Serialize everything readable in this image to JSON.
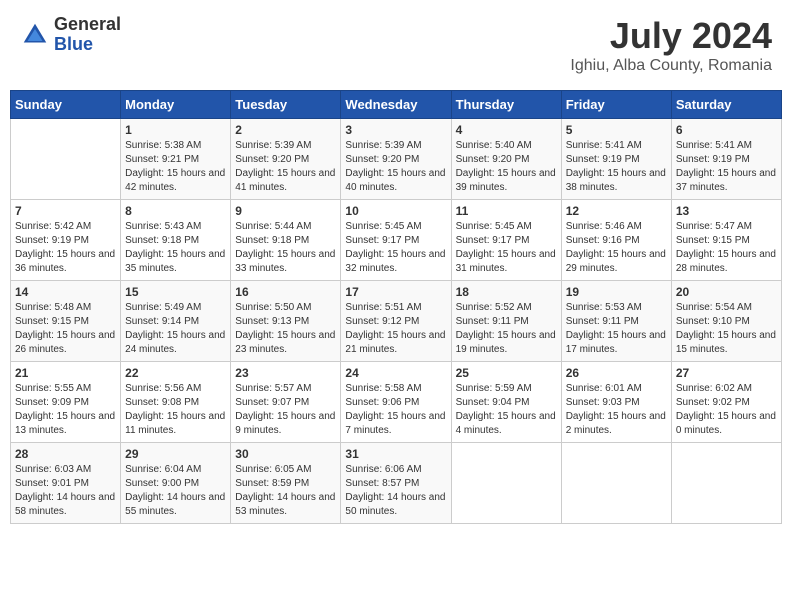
{
  "header": {
    "logo_general": "General",
    "logo_blue": "Blue",
    "month_title": "July 2024",
    "location": "Ighiu, Alba County, Romania"
  },
  "weekdays": [
    "Sunday",
    "Monday",
    "Tuesday",
    "Wednesday",
    "Thursday",
    "Friday",
    "Saturday"
  ],
  "weeks": [
    [
      {
        "day": "",
        "sunrise": "",
        "sunset": "",
        "daylight": ""
      },
      {
        "day": "1",
        "sunrise": "Sunrise: 5:38 AM",
        "sunset": "Sunset: 9:21 PM",
        "daylight": "Daylight: 15 hours and 42 minutes."
      },
      {
        "day": "2",
        "sunrise": "Sunrise: 5:39 AM",
        "sunset": "Sunset: 9:20 PM",
        "daylight": "Daylight: 15 hours and 41 minutes."
      },
      {
        "day": "3",
        "sunrise": "Sunrise: 5:39 AM",
        "sunset": "Sunset: 9:20 PM",
        "daylight": "Daylight: 15 hours and 40 minutes."
      },
      {
        "day": "4",
        "sunrise": "Sunrise: 5:40 AM",
        "sunset": "Sunset: 9:20 PM",
        "daylight": "Daylight: 15 hours and 39 minutes."
      },
      {
        "day": "5",
        "sunrise": "Sunrise: 5:41 AM",
        "sunset": "Sunset: 9:19 PM",
        "daylight": "Daylight: 15 hours and 38 minutes."
      },
      {
        "day": "6",
        "sunrise": "Sunrise: 5:41 AM",
        "sunset": "Sunset: 9:19 PM",
        "daylight": "Daylight: 15 hours and 37 minutes."
      }
    ],
    [
      {
        "day": "7",
        "sunrise": "Sunrise: 5:42 AM",
        "sunset": "Sunset: 9:19 PM",
        "daylight": "Daylight: 15 hours and 36 minutes."
      },
      {
        "day": "8",
        "sunrise": "Sunrise: 5:43 AM",
        "sunset": "Sunset: 9:18 PM",
        "daylight": "Daylight: 15 hours and 35 minutes."
      },
      {
        "day": "9",
        "sunrise": "Sunrise: 5:44 AM",
        "sunset": "Sunset: 9:18 PM",
        "daylight": "Daylight: 15 hours and 33 minutes."
      },
      {
        "day": "10",
        "sunrise": "Sunrise: 5:45 AM",
        "sunset": "Sunset: 9:17 PM",
        "daylight": "Daylight: 15 hours and 32 minutes."
      },
      {
        "day": "11",
        "sunrise": "Sunrise: 5:45 AM",
        "sunset": "Sunset: 9:17 PM",
        "daylight": "Daylight: 15 hours and 31 minutes."
      },
      {
        "day": "12",
        "sunrise": "Sunrise: 5:46 AM",
        "sunset": "Sunset: 9:16 PM",
        "daylight": "Daylight: 15 hours and 29 minutes."
      },
      {
        "day": "13",
        "sunrise": "Sunrise: 5:47 AM",
        "sunset": "Sunset: 9:15 PM",
        "daylight": "Daylight: 15 hours and 28 minutes."
      }
    ],
    [
      {
        "day": "14",
        "sunrise": "Sunrise: 5:48 AM",
        "sunset": "Sunset: 9:15 PM",
        "daylight": "Daylight: 15 hours and 26 minutes."
      },
      {
        "day": "15",
        "sunrise": "Sunrise: 5:49 AM",
        "sunset": "Sunset: 9:14 PM",
        "daylight": "Daylight: 15 hours and 24 minutes."
      },
      {
        "day": "16",
        "sunrise": "Sunrise: 5:50 AM",
        "sunset": "Sunset: 9:13 PM",
        "daylight": "Daylight: 15 hours and 23 minutes."
      },
      {
        "day": "17",
        "sunrise": "Sunrise: 5:51 AM",
        "sunset": "Sunset: 9:12 PM",
        "daylight": "Daylight: 15 hours and 21 minutes."
      },
      {
        "day": "18",
        "sunrise": "Sunrise: 5:52 AM",
        "sunset": "Sunset: 9:11 PM",
        "daylight": "Daylight: 15 hours and 19 minutes."
      },
      {
        "day": "19",
        "sunrise": "Sunrise: 5:53 AM",
        "sunset": "Sunset: 9:11 PM",
        "daylight": "Daylight: 15 hours and 17 minutes."
      },
      {
        "day": "20",
        "sunrise": "Sunrise: 5:54 AM",
        "sunset": "Sunset: 9:10 PM",
        "daylight": "Daylight: 15 hours and 15 minutes."
      }
    ],
    [
      {
        "day": "21",
        "sunrise": "Sunrise: 5:55 AM",
        "sunset": "Sunset: 9:09 PM",
        "daylight": "Daylight: 15 hours and 13 minutes."
      },
      {
        "day": "22",
        "sunrise": "Sunrise: 5:56 AM",
        "sunset": "Sunset: 9:08 PM",
        "daylight": "Daylight: 15 hours and 11 minutes."
      },
      {
        "day": "23",
        "sunrise": "Sunrise: 5:57 AM",
        "sunset": "Sunset: 9:07 PM",
        "daylight": "Daylight: 15 hours and 9 minutes."
      },
      {
        "day": "24",
        "sunrise": "Sunrise: 5:58 AM",
        "sunset": "Sunset: 9:06 PM",
        "daylight": "Daylight: 15 hours and 7 minutes."
      },
      {
        "day": "25",
        "sunrise": "Sunrise: 5:59 AM",
        "sunset": "Sunset: 9:04 PM",
        "daylight": "Daylight: 15 hours and 4 minutes."
      },
      {
        "day": "26",
        "sunrise": "Sunrise: 6:01 AM",
        "sunset": "Sunset: 9:03 PM",
        "daylight": "Daylight: 15 hours and 2 minutes."
      },
      {
        "day": "27",
        "sunrise": "Sunrise: 6:02 AM",
        "sunset": "Sunset: 9:02 PM",
        "daylight": "Daylight: 15 hours and 0 minutes."
      }
    ],
    [
      {
        "day": "28",
        "sunrise": "Sunrise: 6:03 AM",
        "sunset": "Sunset: 9:01 PM",
        "daylight": "Daylight: 14 hours and 58 minutes."
      },
      {
        "day": "29",
        "sunrise": "Sunrise: 6:04 AM",
        "sunset": "Sunset: 9:00 PM",
        "daylight": "Daylight: 14 hours and 55 minutes."
      },
      {
        "day": "30",
        "sunrise": "Sunrise: 6:05 AM",
        "sunset": "Sunset: 8:59 PM",
        "daylight": "Daylight: 14 hours and 53 minutes."
      },
      {
        "day": "31",
        "sunrise": "Sunrise: 6:06 AM",
        "sunset": "Sunset: 8:57 PM",
        "daylight": "Daylight: 14 hours and 50 minutes."
      },
      {
        "day": "",
        "sunrise": "",
        "sunset": "",
        "daylight": ""
      },
      {
        "day": "",
        "sunrise": "",
        "sunset": "",
        "daylight": ""
      },
      {
        "day": "",
        "sunrise": "",
        "sunset": "",
        "daylight": ""
      }
    ]
  ]
}
